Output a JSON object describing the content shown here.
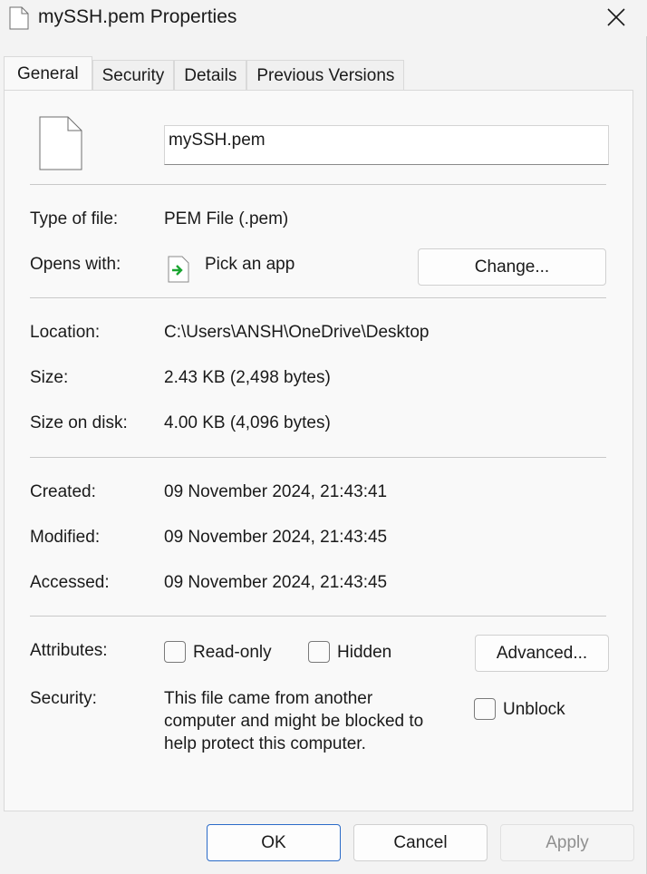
{
  "window": {
    "title": "mySSH.pem Properties",
    "title_icon": "file-icon",
    "close_icon": "close-icon"
  },
  "tabs": [
    {
      "label": "General",
      "active": true
    },
    {
      "label": "Security",
      "active": false
    },
    {
      "label": "Details",
      "active": false
    },
    {
      "label": "Previous Versions",
      "active": false
    }
  ],
  "general": {
    "file_name": "mySSH.pem",
    "type_label": "Type of file:",
    "type_value": "PEM File (.pem)",
    "opens_label": "Opens with:",
    "opens_value": "Pick an app",
    "change_button": "Change...",
    "location_label": "Location:",
    "location_value": "C:\\Users\\ANSH\\OneDrive\\Desktop",
    "size_label": "Size:",
    "size_value": "2.43 KB (2,498 bytes)",
    "size_disk_label": "Size on disk:",
    "size_disk_value": "4.00 KB (4,096 bytes)",
    "created_label": "Created:",
    "created_value": "09 November 2024, 21:43:41",
    "modified_label": "Modified:",
    "modified_value": "09 November 2024, 21:43:45",
    "accessed_label": "Accessed:",
    "accessed_value": "09 November 2024, 21:43:45",
    "attributes_label": "Attributes:",
    "readonly_label": "Read-only",
    "readonly_checked": false,
    "hidden_label": "Hidden",
    "hidden_checked": false,
    "advanced_button": "Advanced...",
    "security_label": "Security:",
    "security_line1": "This file came from another",
    "security_line2": "computer and might be blocked to",
    "security_line3": "help protect this computer.",
    "unblock_label": "Unblock",
    "unblock_checked": false
  },
  "footer": {
    "ok": "OK",
    "cancel": "Cancel",
    "apply": "Apply"
  },
  "colors": {
    "accent": "#2b6bc8",
    "open_with_arrow": "#1aa531"
  }
}
